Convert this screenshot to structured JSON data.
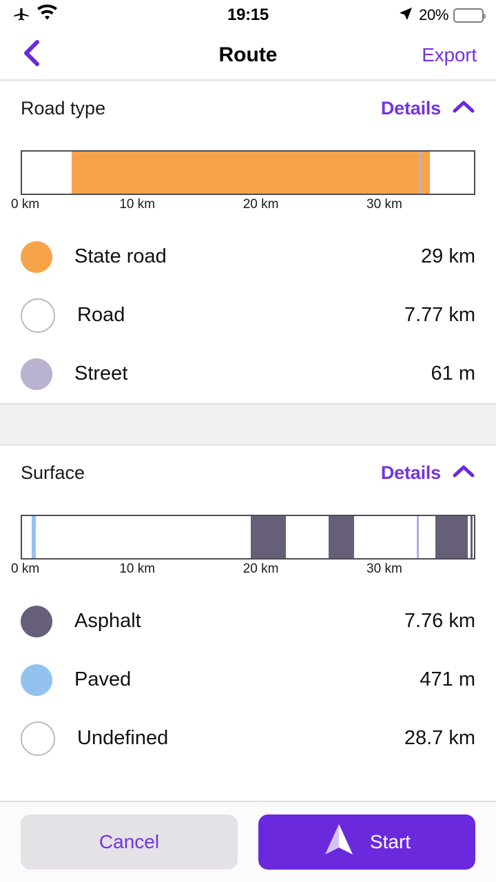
{
  "status_bar": {
    "airplane_icon": "airplane-mode-icon",
    "wifi_icon": "wifi-icon",
    "time": "19:15",
    "location_icon": "location-arrow-icon",
    "battery_percent": "20%",
    "battery_level": 20,
    "battery_color": "#f3261b"
  },
  "nav": {
    "back_icon": "chevron-left-icon",
    "title": "Route",
    "export_label": "Export",
    "accent_color": "#7433e0"
  },
  "sections": [
    {
      "id": "road-type",
      "title": "Road type",
      "details_label": "Details",
      "collapse_icon": "chevron-up-icon",
      "axis_ticks": [
        "0 km",
        "10 km",
        "20 km",
        "30 km"
      ],
      "legend": [
        {
          "label": "State road",
          "value": "29 km",
          "color": "#f7a34a",
          "outlined": false
        },
        {
          "label": "Road",
          "value": "7.77 km",
          "color": "#ffffff",
          "outlined": true
        },
        {
          "label": "Street",
          "value": "61 m",
          "color": "#b9b2d0",
          "outlined": false
        }
      ]
    },
    {
      "id": "surface",
      "title": "Surface",
      "details_label": "Details",
      "collapse_icon": "chevron-up-icon",
      "axis_ticks": [
        "0 km",
        "10 km",
        "20 km",
        "30 km"
      ],
      "legend": [
        {
          "label": "Asphalt",
          "value": "7.76 km",
          "color": "#665f77",
          "outlined": false
        },
        {
          "label": "Paved",
          "value": "471 m",
          "color": "#93c2f0",
          "outlined": false
        },
        {
          "label": "Undefined",
          "value": "28.7 km",
          "color": "#ffffff",
          "outlined": true
        }
      ]
    }
  ],
  "footer": {
    "cancel_label": "Cancel",
    "start_label": "Start",
    "start_icon": "navigation-arrow-icon"
  },
  "chart_data": [
    {
      "type": "bar",
      "id": "road-type-distribution",
      "title": "Road type",
      "orientation": "horizontal-stacked",
      "xlabel": "",
      "ylabel": "",
      "axis_ticks": [
        0,
        10,
        20,
        30
      ],
      "tick_labels": [
        "0 km",
        "10 km",
        "20 km",
        "30 km"
      ],
      "xlim": [
        0,
        36.8
      ],
      "total_distance_km": 36.83,
      "categories": [
        "State road",
        "Road",
        "Street"
      ],
      "values": [
        29,
        7.77,
        0.061
      ],
      "value_labels": [
        "29 km",
        "7.77 km",
        "61 m"
      ],
      "colors": [
        "#f7a34a",
        "#ffffff",
        "#b9b2d0"
      ],
      "segments": [
        {
          "category": "Road",
          "start_pct": 0.0,
          "end_pct": 11.0,
          "color": "#ffffff"
        },
        {
          "category": "State road",
          "start_pct": 11.0,
          "end_pct": 87.8,
          "color": "#f7a34a"
        },
        {
          "category": "Street",
          "start_pct": 87.8,
          "end_pct": 88.3,
          "color": "#b9b2d0"
        },
        {
          "category": "State road",
          "start_pct": 88.3,
          "end_pct": 90.2,
          "color": "#f7a34a"
        },
        {
          "category": "Road",
          "start_pct": 90.2,
          "end_pct": 100.0,
          "color": "#ffffff"
        }
      ]
    },
    {
      "type": "bar",
      "id": "surface-distribution",
      "title": "Surface",
      "orientation": "horizontal-stacked",
      "xlabel": "",
      "ylabel": "",
      "axis_ticks": [
        0,
        10,
        20,
        30
      ],
      "tick_labels": [
        "0 km",
        "10 km",
        "20 km",
        "30 km"
      ],
      "xlim": [
        0,
        36.8
      ],
      "total_distance_km": 36.93,
      "categories": [
        "Asphalt",
        "Paved",
        "Undefined"
      ],
      "values": [
        7.76,
        0.471,
        28.7
      ],
      "value_labels": [
        "7.76 km",
        "471 m",
        "28.7 km"
      ],
      "colors": [
        "#665f77",
        "#93c2f0",
        "#ffffff"
      ],
      "segments": [
        {
          "category": "Undefined",
          "start_pct": 0.0,
          "end_pct": 2.1,
          "color": "#ffffff"
        },
        {
          "category": "Paved",
          "start_pct": 2.1,
          "end_pct": 3.0,
          "color": "#93c2f0"
        },
        {
          "category": "Undefined",
          "start_pct": 3.0,
          "end_pct": 50.6,
          "color": "#ffffff"
        },
        {
          "category": "Asphalt",
          "start_pct": 50.6,
          "end_pct": 58.4,
          "color": "#665f77"
        },
        {
          "category": "Undefined",
          "start_pct": 58.4,
          "end_pct": 67.9,
          "color": "#ffffff"
        },
        {
          "category": "Asphalt",
          "start_pct": 67.9,
          "end_pct": 73.5,
          "color": "#665f77"
        },
        {
          "category": "Undefined",
          "start_pct": 73.5,
          "end_pct": 87.3,
          "color": "#ffffff"
        },
        {
          "category": "Paved",
          "start_pct": 87.3,
          "end_pct": 87.8,
          "color": "#b9a6e0"
        },
        {
          "category": "Undefined",
          "start_pct": 87.8,
          "end_pct": 91.4,
          "color": "#ffffff"
        },
        {
          "category": "Asphalt",
          "start_pct": 91.4,
          "end_pct": 98.6,
          "color": "#665f77"
        },
        {
          "category": "Undefined",
          "start_pct": 98.6,
          "end_pct": 99.2,
          "color": "#ffffff"
        },
        {
          "category": "Asphalt",
          "start_pct": 99.2,
          "end_pct": 99.7,
          "color": "#665f77"
        }
      ]
    }
  ]
}
